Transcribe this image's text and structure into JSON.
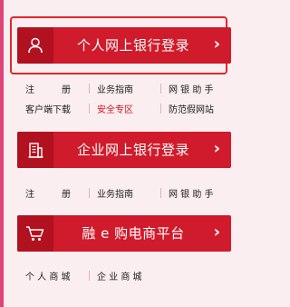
{
  "personal_banking": {
    "label": "个人网上银行登录",
    "icon": "user-icon",
    "chevron": "›"
  },
  "personal_links": {
    "row1": [
      "注　　　册",
      "业务指南",
      "网 银 助 手"
    ],
    "row2": [
      "客户端下载",
      "安全专区",
      "防范假网站"
    ]
  },
  "corporate_banking": {
    "label": "企业网上银行登录",
    "icon": "building-icon",
    "chevron": "›"
  },
  "corporate_links": {
    "row1": [
      "注　　　册",
      "业务指南",
      "网 银 助 手"
    ]
  },
  "ecommerce": {
    "label": "融 e 购电商平台",
    "icon": "shopping-cart-icon",
    "chevron": "›"
  },
  "ecommerce_links": {
    "row1": [
      "个 人 商 城",
      "企 业 商 城"
    ]
  },
  "colors": {
    "button_red": "#cf1b2b",
    "icon_cell_red": "#b2111f",
    "highlight_border": "#e3262c",
    "link_red": "#d4121f"
  }
}
